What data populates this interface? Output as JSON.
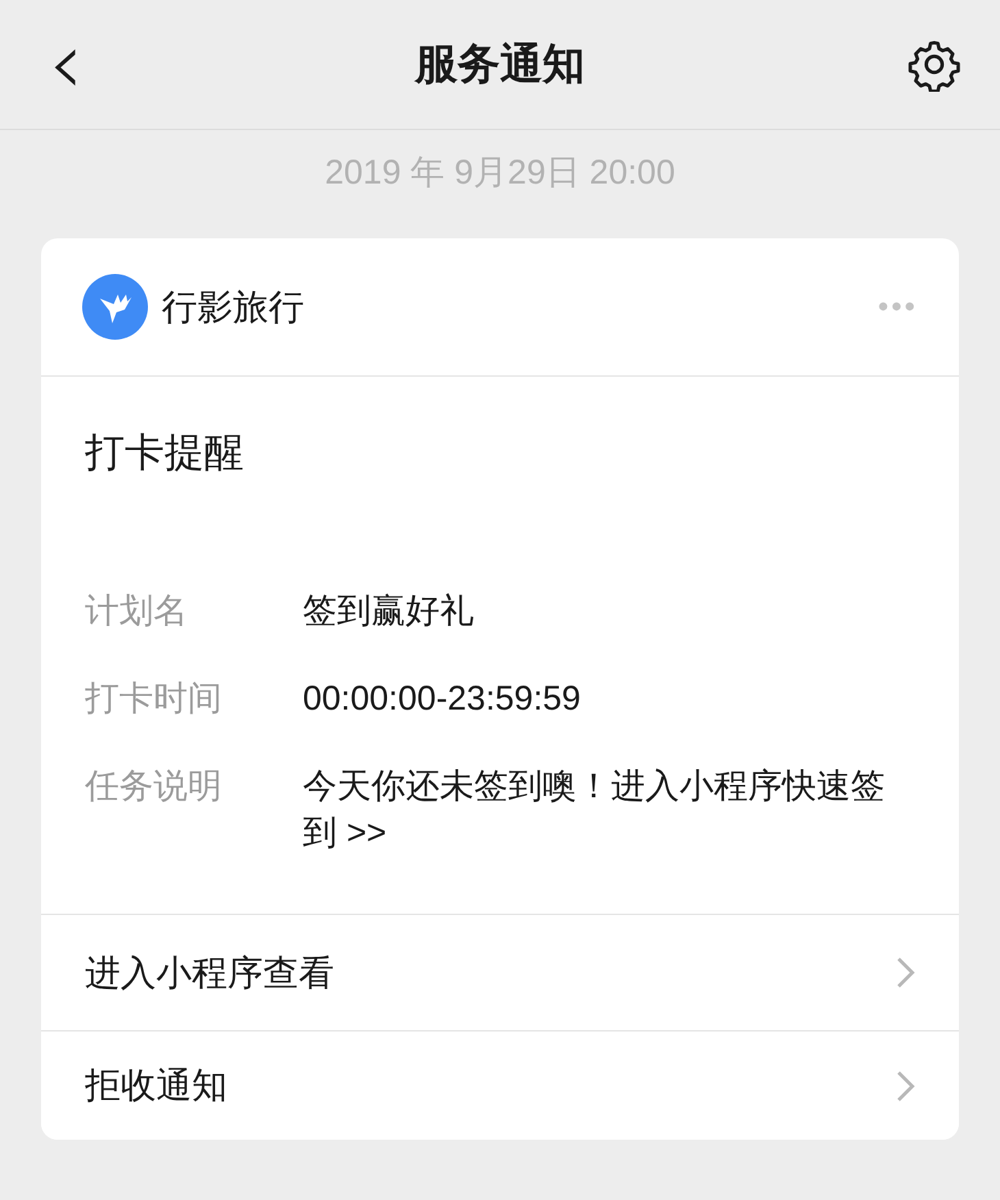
{
  "nav": {
    "back": "‹",
    "title": "服务通知"
  },
  "timestamp": "2019 年 9月29日 20:00",
  "card": {
    "source": "行影旅行",
    "more": "•••",
    "title": "打卡提醒",
    "fields": [
      {
        "label": "计划名",
        "value": "签到赢好礼"
      },
      {
        "label": "打卡时间",
        "value": "00:00:00-23:59:59"
      },
      {
        "label": "任务说明",
        "value": "今天你还未签到噢！进入小程序快速签到 >>"
      }
    ],
    "actions": [
      {
        "label": "进入小程序查看"
      },
      {
        "label": "拒收通知"
      }
    ]
  }
}
